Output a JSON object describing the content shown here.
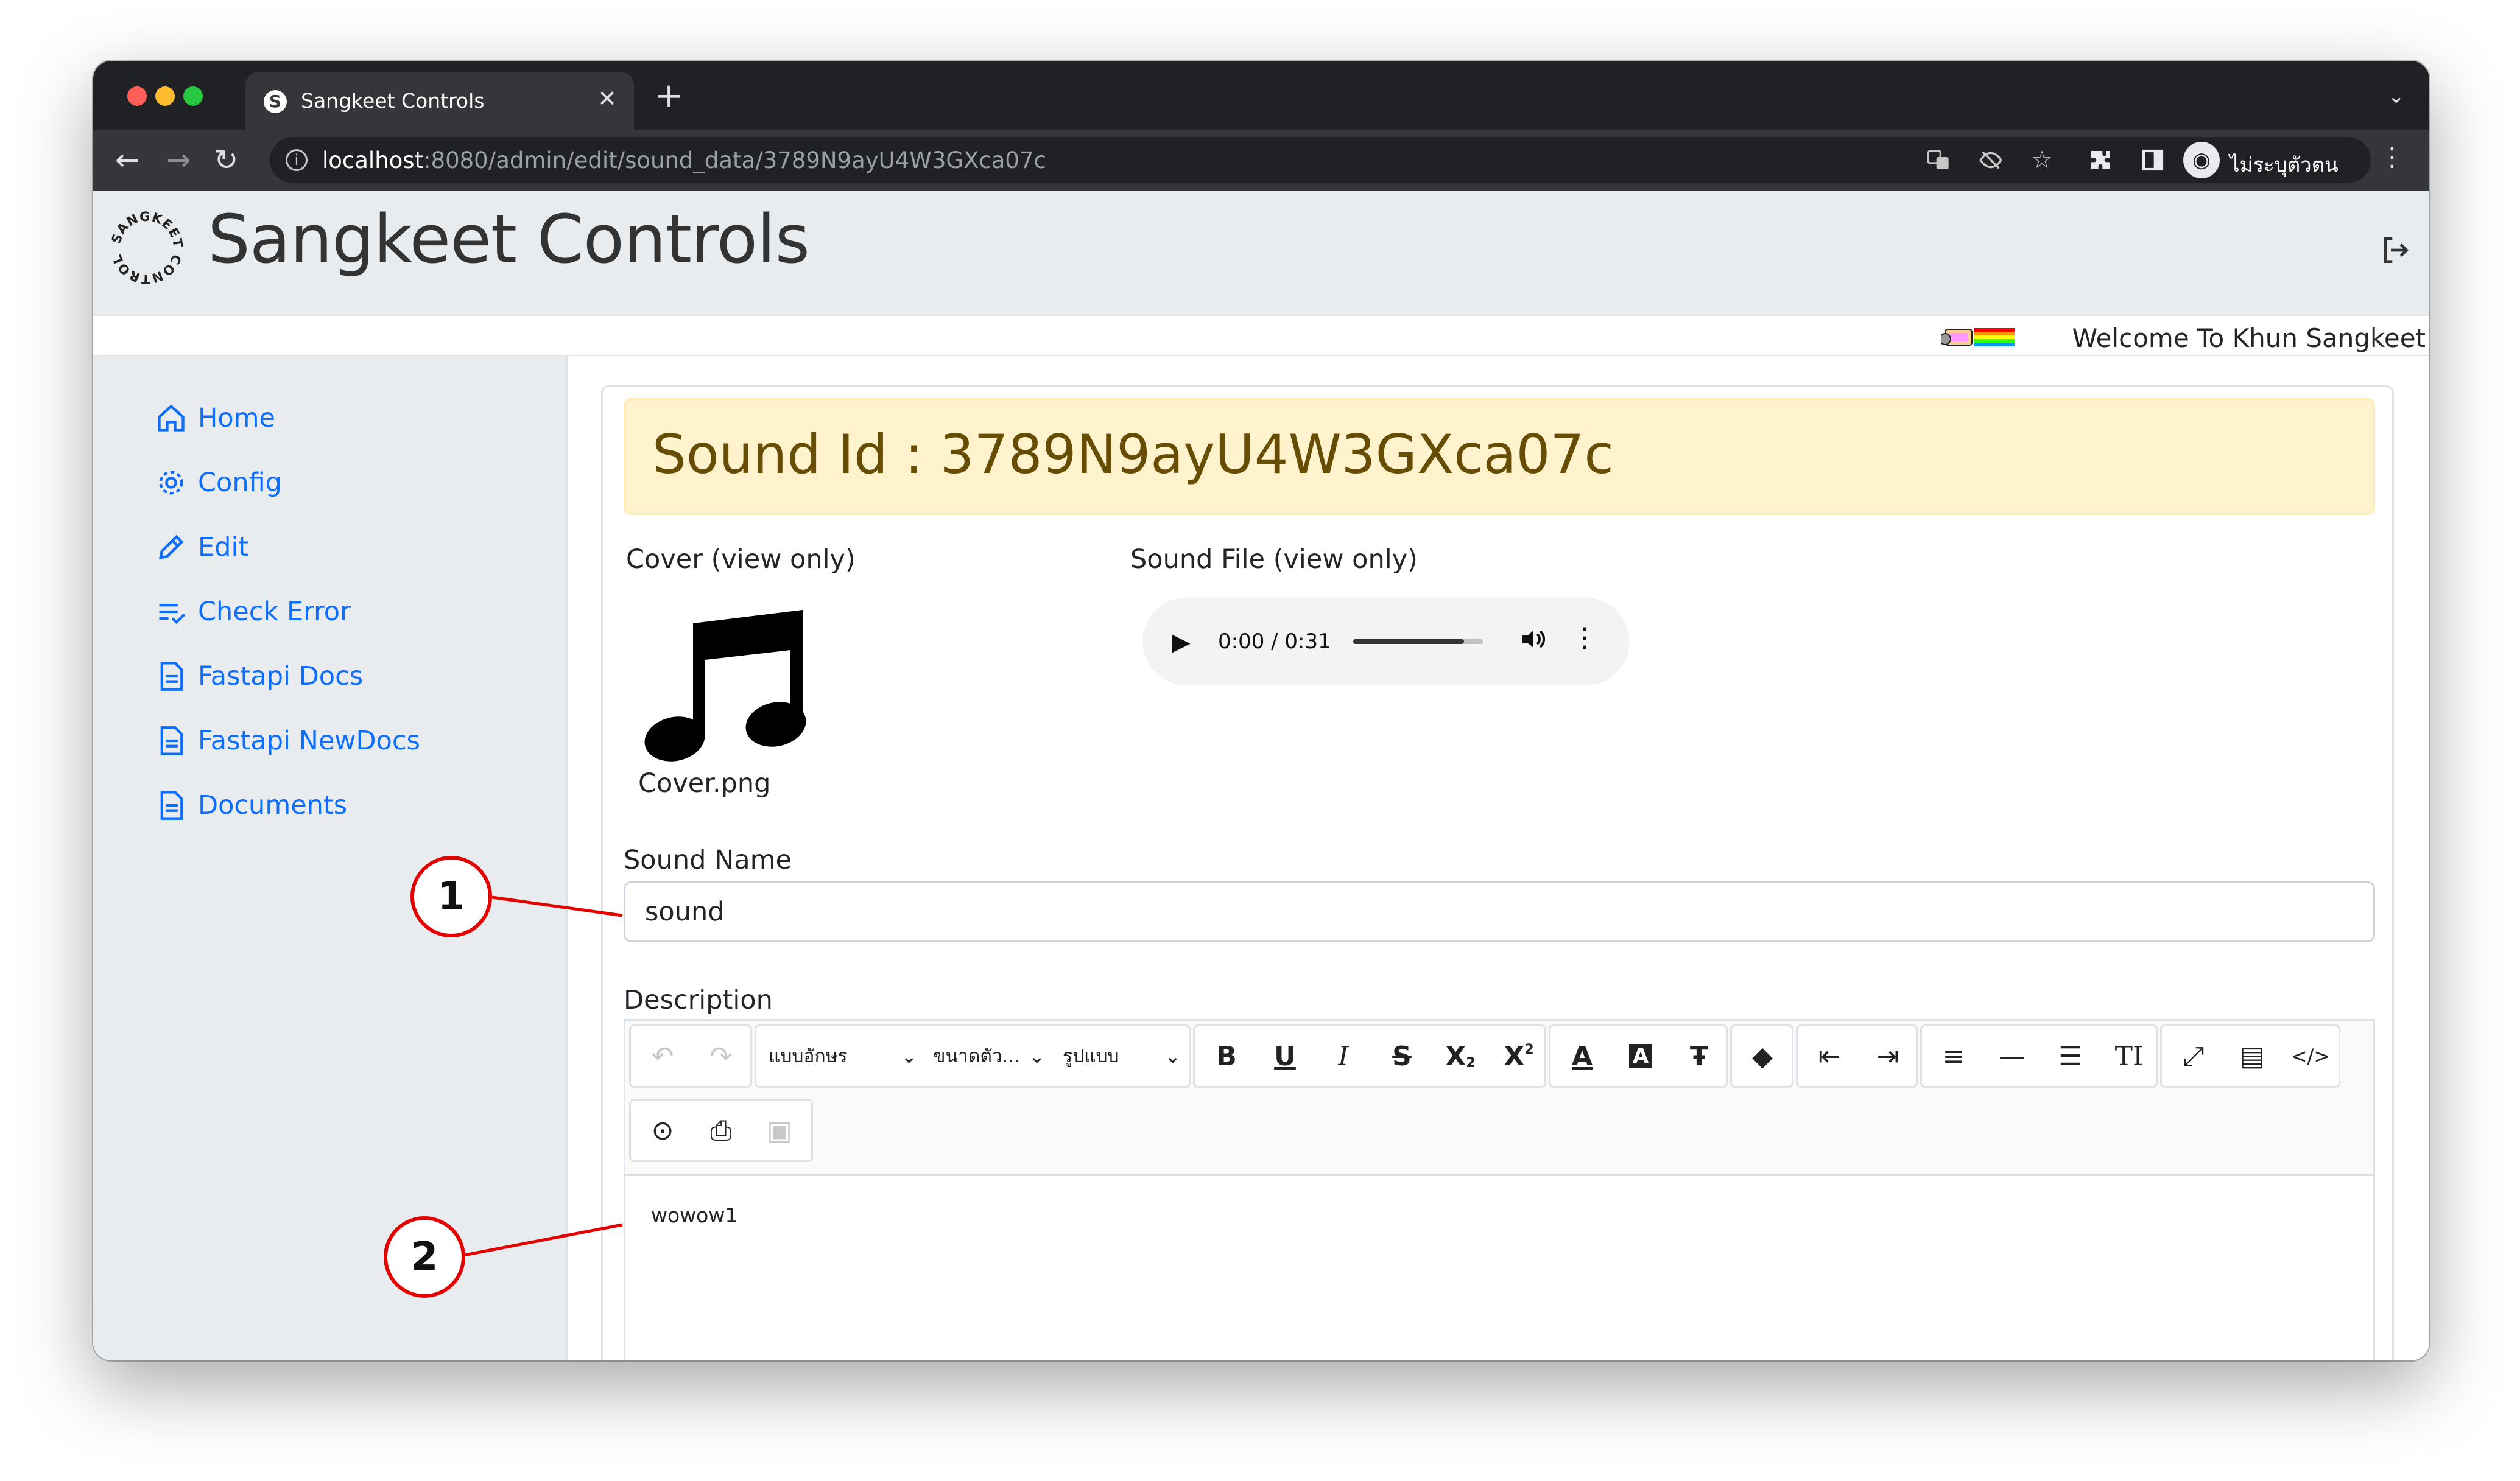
{
  "browser": {
    "tab_title": "Sangkeet Controls",
    "url_host": "localhost",
    "url_path": ":8080/admin/edit/sound_data/3789N9ayU4W3GXca07c",
    "profile_name": "ไม่ระบุตัวตน",
    "traffic_lights": [
      "#ff5f57",
      "#febc2e",
      "#28c840"
    ]
  },
  "header": {
    "title": "Sangkeet Controls",
    "logo_text": "SANGKEET CONTROL",
    "welcome": "Welcome To Khun Sangkeet"
  },
  "sidebar": {
    "items": [
      {
        "label": "Home",
        "icon": "home-icon"
      },
      {
        "label": "Config",
        "icon": "gear-icon"
      },
      {
        "label": "Edit",
        "icon": "pencil-icon"
      },
      {
        "label": "Check Error",
        "icon": "list-check-icon"
      },
      {
        "label": "Fastapi Docs",
        "icon": "document-icon"
      },
      {
        "label": "Fastapi NewDocs",
        "icon": "document-icon"
      },
      {
        "label": "Documents",
        "icon": "document-icon"
      }
    ]
  },
  "main": {
    "sound_id_heading": "Sound Id : 3789N9ayU4W3GXca07c",
    "cover_label": "Cover (view only)",
    "cover_filename": "Cover.png",
    "sound_file_label": "Sound File (view only)",
    "audio": {
      "time": "0:00 / 0:31",
      "volume_level": 0.85
    },
    "sound_name_label": "Sound Name",
    "sound_name_value": "sound",
    "description_label": "Description",
    "description_value": "wowow1"
  },
  "editor_toolbar": {
    "font_select": "แบบอักษร",
    "size_select": "ขนาดตัว...",
    "format_select": "รูปแบบ"
  },
  "callouts": [
    "1",
    "2"
  ],
  "colors": {
    "link": "#0d6efd",
    "alert_bg": "#fff3cd",
    "alert_text": "#664d03",
    "callout_red": "#e50000"
  }
}
